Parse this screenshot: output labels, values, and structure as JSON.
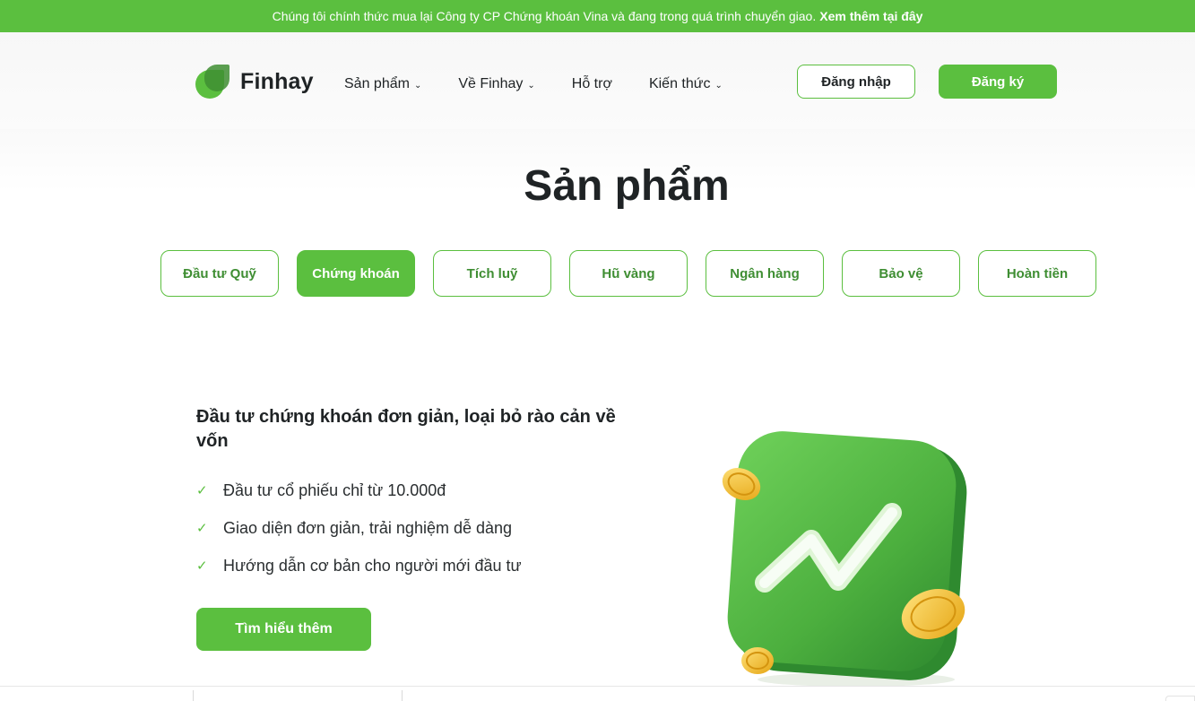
{
  "banner": {
    "text": "Chúng tôi chính thức mua lại Công ty CP Chứng khoán Vina và đang trong quá trình chuyển giao.",
    "link": "Xem thêm tại đây"
  },
  "header": {
    "logo_text": "Finhay",
    "nav": [
      {
        "label": "Sản phẩm",
        "has_dropdown": true
      },
      {
        "label": "Về Finhay",
        "has_dropdown": true
      },
      {
        "label": "Hỗ trợ",
        "has_dropdown": false
      },
      {
        "label": "Kiến thức",
        "has_dropdown": true
      }
    ],
    "login_label": "Đăng nhập",
    "signup_label": "Đăng ký"
  },
  "main": {
    "title": "Sản phẩm",
    "tabs": [
      {
        "label": "Đầu tư Quỹ",
        "active": false
      },
      {
        "label": "Chứng khoán",
        "active": true
      },
      {
        "label": "Tích luỹ",
        "active": false
      },
      {
        "label": "Hũ vàng",
        "active": false
      },
      {
        "label": "Ngân hàng",
        "active": false
      },
      {
        "label": "Bảo vệ",
        "active": false
      },
      {
        "label": "Hoàn tiền",
        "active": false
      }
    ],
    "heading": "Đầu tư chứng khoán đơn giản, loại bỏ rào cản về vốn",
    "features": [
      "Đầu tư cổ phiếu chỉ từ 10.000đ",
      "Giao diện đơn giản, trải nghiệm dễ dàng",
      "Hướng dẫn cơ bản cho người mới đầu tư"
    ],
    "cta_label": "Tìm hiểu thêm"
  },
  "colors": {
    "brand_green": "#5bbf3f",
    "dark_green": "#3f8e33",
    "text": "#1f2325"
  },
  "icons": {
    "logo": "finhay-leaf-logo",
    "chevron": "chevron-down-icon",
    "check": "check-icon",
    "illustration": "stock-chart-app-with-coins"
  }
}
